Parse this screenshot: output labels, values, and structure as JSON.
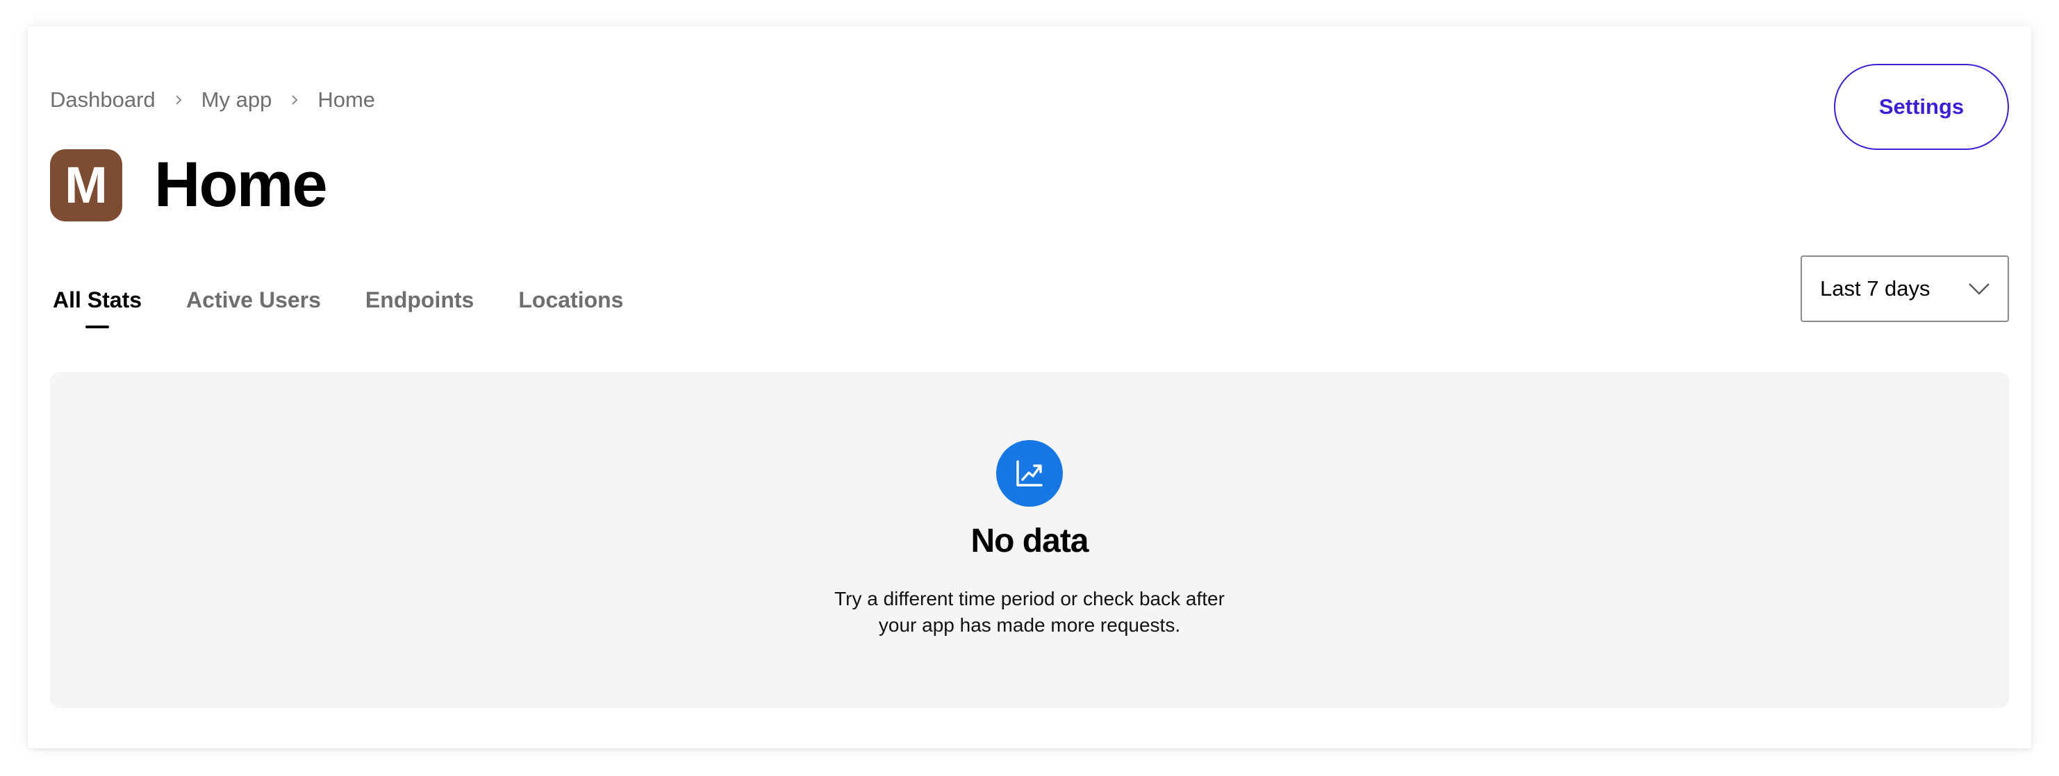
{
  "breadcrumb": {
    "items": [
      {
        "label": "Dashboard"
      },
      {
        "label": "My app"
      },
      {
        "label": "Home"
      }
    ]
  },
  "app": {
    "avatar_letter": "M",
    "avatar_color": "#7d4c32"
  },
  "page": {
    "title": "Home"
  },
  "header": {
    "settings_label": "Settings",
    "accent_color": "#3b1fd4"
  },
  "tabs": [
    {
      "label": "All Stats",
      "active": true
    },
    {
      "label": "Active Users",
      "active": false
    },
    {
      "label": "Endpoints",
      "active": false
    },
    {
      "label": "Locations",
      "active": false
    }
  ],
  "range_select": {
    "value": "Last 7 days",
    "icon": "chevron-down-icon"
  },
  "empty_state": {
    "icon": "trending-up-chart-icon",
    "icon_color": "#1677e5",
    "title": "No data",
    "line1": "Try a different time period or check back after",
    "line2": "your app has made more requests."
  }
}
